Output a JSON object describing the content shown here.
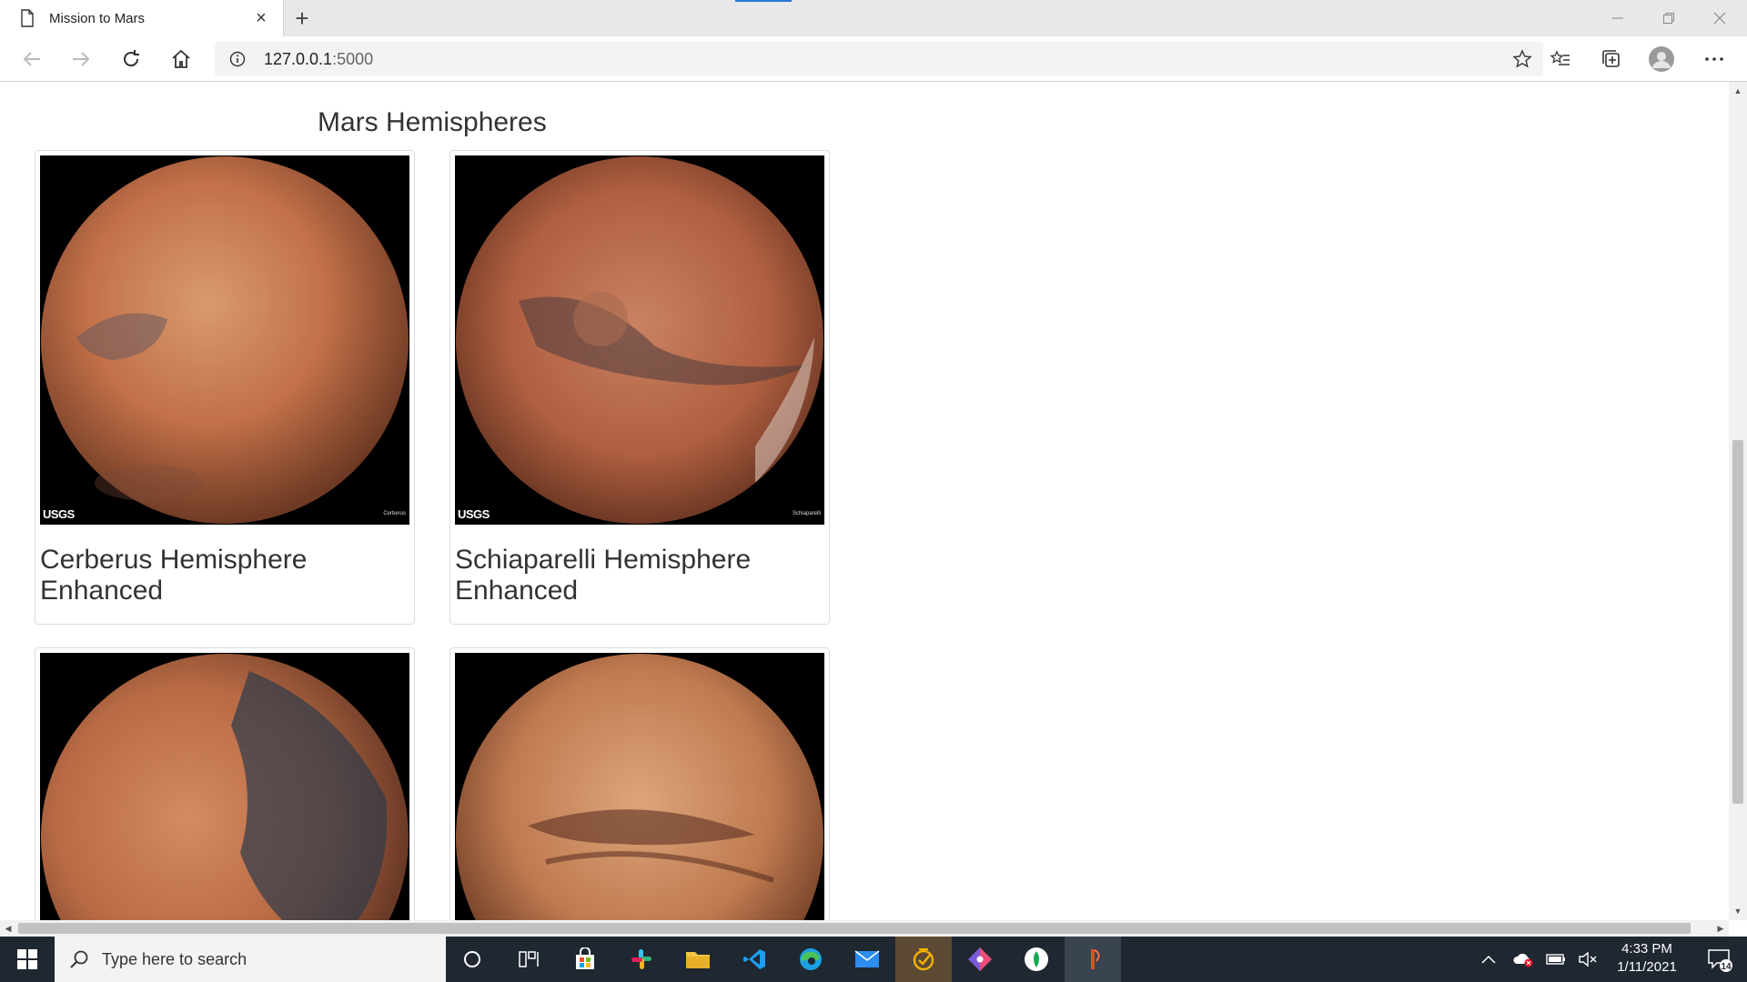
{
  "browser": {
    "tab_title": "Mission to Mars",
    "url_host": "127.0.0.1",
    "url_port": ":5000"
  },
  "page": {
    "section_title": "Mars Hemispheres",
    "hemispheres": [
      {
        "title": "Cerberus Hemisphere Enhanced",
        "image_label": "Cerberus",
        "logo": "USGS"
      },
      {
        "title": "Schiaparelli Hemisphere Enhanced",
        "image_label": "Schiaparelli",
        "logo": "USGS"
      },
      {
        "title": "",
        "image_label": "",
        "logo": ""
      },
      {
        "title": "",
        "image_label": "",
        "logo": ""
      }
    ]
  },
  "taskbar": {
    "search_placeholder": "Type here to search",
    "time": "4:33 PM",
    "date": "1/11/2021",
    "notification_count": "14"
  },
  "colors": {
    "taskbar_bg": "#1f2731",
    "tab_accent": "#2a78d6"
  }
}
